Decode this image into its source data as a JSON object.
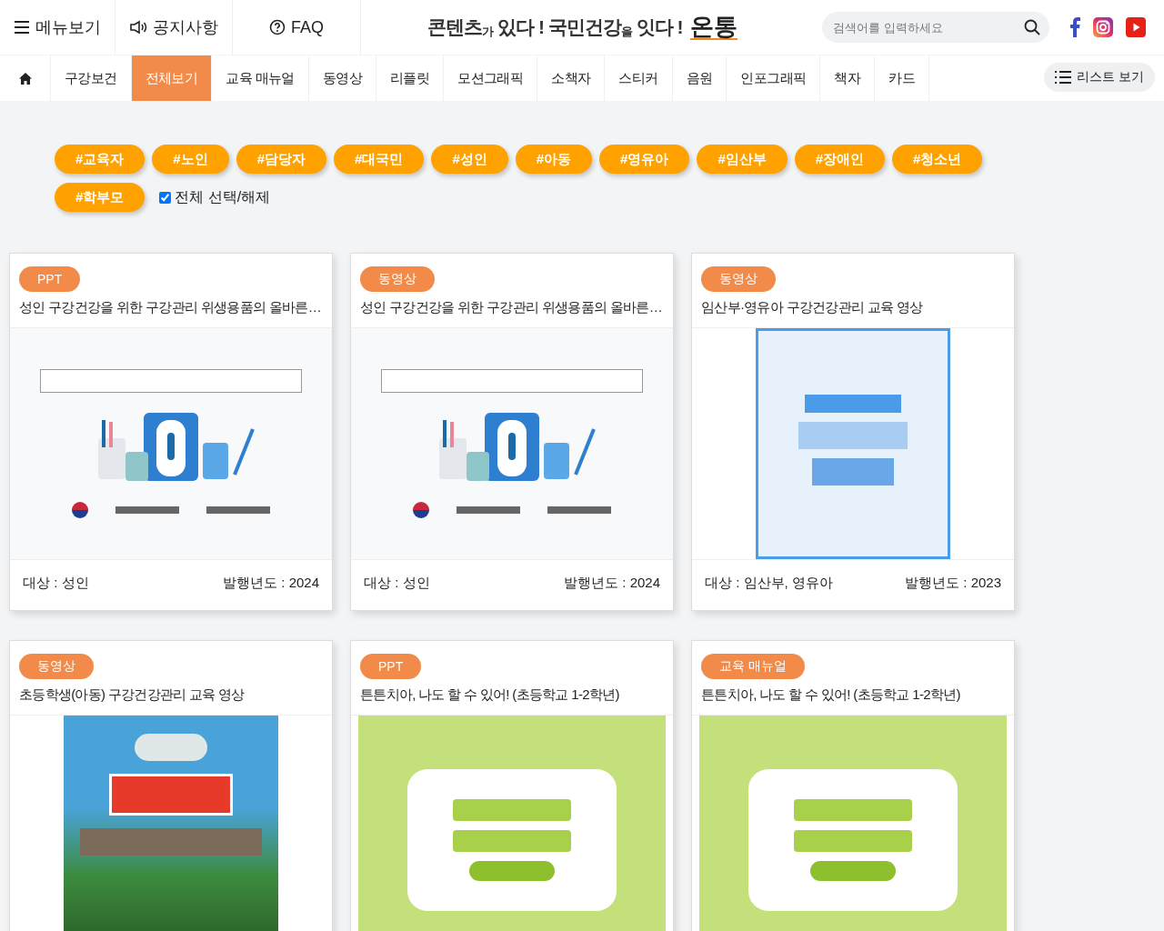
{
  "top_links": [
    {
      "kind": "menu",
      "label": "메뉴보기"
    },
    {
      "kind": "notice",
      "label": "공지사항"
    },
    {
      "kind": "faq",
      "label": "FAQ"
    }
  ],
  "logo": {
    "slogan": "콘텐츠$_{가}$ 있다 ! 국민건강$_{을}$ 잇다 !",
    "brand": "온통"
  },
  "search": {
    "placeholder": "검색어를 입력하세요"
  },
  "social": [
    {
      "kind": "facebook"
    },
    {
      "kind": "instagram"
    },
    {
      "kind": "youtube"
    }
  ],
  "nav": [
    {
      "label": "구강보건",
      "selected": false
    },
    {
      "label": "전체보기",
      "selected": true
    },
    {
      "label": "교육 매뉴얼",
      "selected": false
    },
    {
      "label": "동영상",
      "selected": false
    },
    {
      "label": "리플릿",
      "selected": false
    },
    {
      "label": "모션그래픽",
      "selected": false
    },
    {
      "label": "소책자",
      "selected": false
    },
    {
      "label": "스티커",
      "selected": false
    },
    {
      "label": "음원",
      "selected": false
    },
    {
      "label": "인포그래픽",
      "selected": false
    },
    {
      "label": "책자",
      "selected": false
    },
    {
      "label": "카드",
      "selected": false
    }
  ],
  "list_view_button": "리스트 보기",
  "tags": [
    "#교육자",
    "#노인",
    "#담당자",
    "#대국민",
    "#성인",
    "#아동",
    "#영유아",
    "#임산부",
    "#장애인",
    "#청소년",
    "#학부모"
  ],
  "select_all": {
    "label": "전체 선택/해제",
    "checked": true
  },
  "cards": [
    {
      "badge": "PPT",
      "title": "성인 구강건강을 위한 구강관리 위생용품의 올바른…",
      "thumbnail": {
        "kind": "illustration"
      },
      "target": "대상 : 성인",
      "year": "발행년도 : 2024"
    },
    {
      "badge": "동영상",
      "title": "성인 구강건강을 위한 구강관리 위생용품의 올바른…",
      "thumbnail": {
        "kind": "illustration"
      },
      "target": "대상 : 성인",
      "year": "발행년도 : 2024"
    },
    {
      "badge": "동영상",
      "title": "임산부·영유아 구강건강관리 교육 영상",
      "thumbnail": {
        "kind": "blue-cover"
      },
      "target": "대상 : 임산부, 영유아",
      "year": "발행년도 : 2023"
    },
    {
      "badge": "동영상",
      "title": "초등학생(아동) 구강건강관리 교육 영상",
      "thumbnail": {
        "kind": "game-cover"
      }
    },
    {
      "badge": "PPT",
      "title": "튼튼치아, 나도 할 수 있어! (초등학교 1-2학년)",
      "thumbnail": {
        "kind": "green-cover"
      }
    },
    {
      "badge": "교육 매뉴얼",
      "title": "튼튼치아, 나도 할 수 있어! (초등학교 1-2학년)",
      "thumbnail": {
        "kind": "green-cover"
      }
    }
  ]
}
